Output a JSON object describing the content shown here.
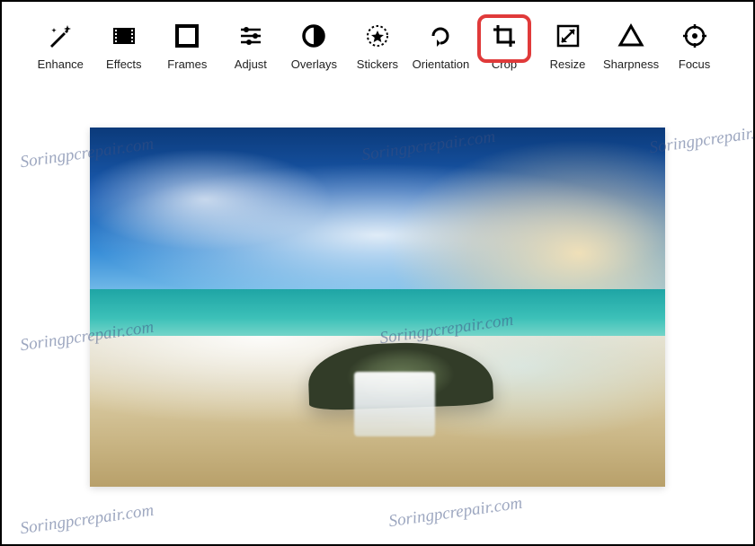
{
  "toolbar": {
    "items": [
      {
        "id": "enhance",
        "label": "Enhance"
      },
      {
        "id": "effects",
        "label": "Effects"
      },
      {
        "id": "frames",
        "label": "Frames"
      },
      {
        "id": "adjust",
        "label": "Adjust"
      },
      {
        "id": "overlays",
        "label": "Overlays"
      },
      {
        "id": "stickers",
        "label": "Stickers"
      },
      {
        "id": "orientation",
        "label": "Orientation"
      },
      {
        "id": "crop",
        "label": "Crop",
        "highlighted": true
      },
      {
        "id": "resize",
        "label": "Resize"
      },
      {
        "id": "sharpness",
        "label": "Sharpness"
      },
      {
        "id": "focus",
        "label": "Focus"
      }
    ]
  },
  "watermark_text": "Soringpcrepair.com",
  "colors": {
    "highlight_border": "#e03a3a",
    "icon_color": "#000000",
    "label_color": "#222222"
  }
}
